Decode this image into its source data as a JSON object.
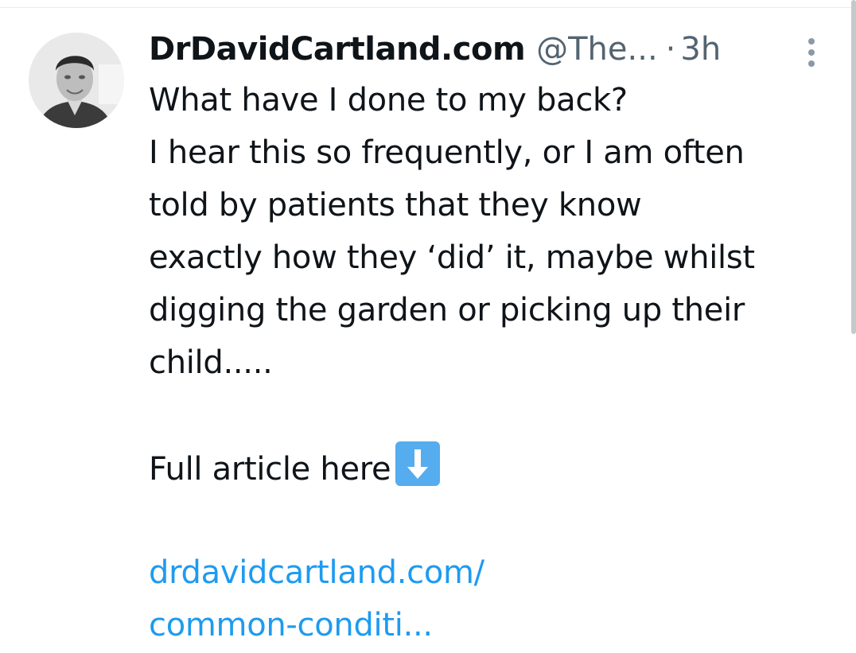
{
  "tweet": {
    "author": {
      "display_name": "DrDavidCartland.com",
      "handle": "@The...",
      "avatar_icon": "profile-photo"
    },
    "separator": "·",
    "timestamp": "3h",
    "more_icon": "vertical-ellipsis-icon",
    "lines": [
      "What have I done to my back?",
      "I hear this so frequently, or I am often",
      "told by patients that they know",
      "exactly how they ‘did’ it, maybe whilst",
      "digging the garden or picking up their",
      "child....."
    ],
    "cta_text": "Full article here",
    "cta_emoji": "down-arrow-emoji",
    "link_lines": [
      "drdavidcartland.com/",
      "common-conditi..."
    ]
  },
  "colors": {
    "text": "#0f1419",
    "secondary": "#536471",
    "link": "#1d9bf0",
    "emoji_bg": "#55acee"
  }
}
